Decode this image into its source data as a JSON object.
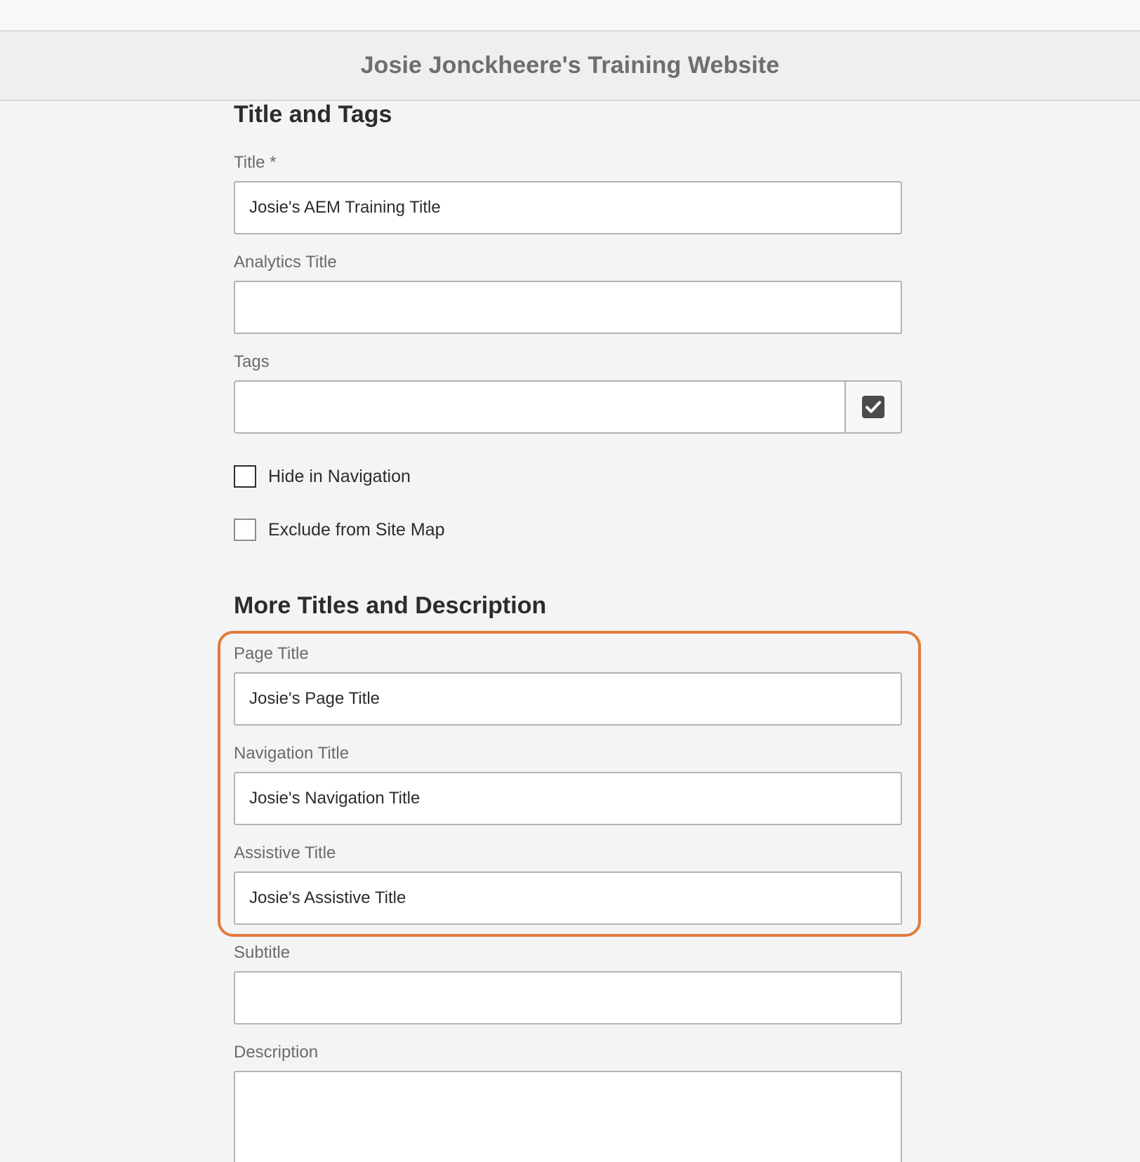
{
  "header": {
    "title": "Josie Jonckheere's Training Website"
  },
  "sections": {
    "title_and_tags": "Title and Tags",
    "more_titles": "More Titles and Description"
  },
  "fields": {
    "title": {
      "label": "Title *",
      "value": "Josie's AEM Training Title"
    },
    "analytics_title": {
      "label": "Analytics Title",
      "value": ""
    },
    "tags": {
      "label": "Tags",
      "value": ""
    },
    "page_title": {
      "label": "Page Title",
      "value": "Josie's Page Title"
    },
    "navigation_title": {
      "label": "Navigation Title",
      "value": "Josie's Navigation Title"
    },
    "assistive_title": {
      "label": "Assistive Title",
      "value": "Josie's Assistive Title"
    },
    "subtitle": {
      "label": "Subtitle",
      "value": ""
    },
    "description": {
      "label": "Description",
      "value": ""
    }
  },
  "checkboxes": {
    "hide_in_navigation": {
      "label": "Hide in Navigation",
      "checked": false
    },
    "exclude_from_sitemap": {
      "label": "Exclude from Site Map",
      "checked": false
    }
  },
  "icons": {
    "tags_picker": "checkbox-checked-icon"
  },
  "colors": {
    "highlight": "#e27a3c",
    "icon": "#4b4b4b"
  }
}
